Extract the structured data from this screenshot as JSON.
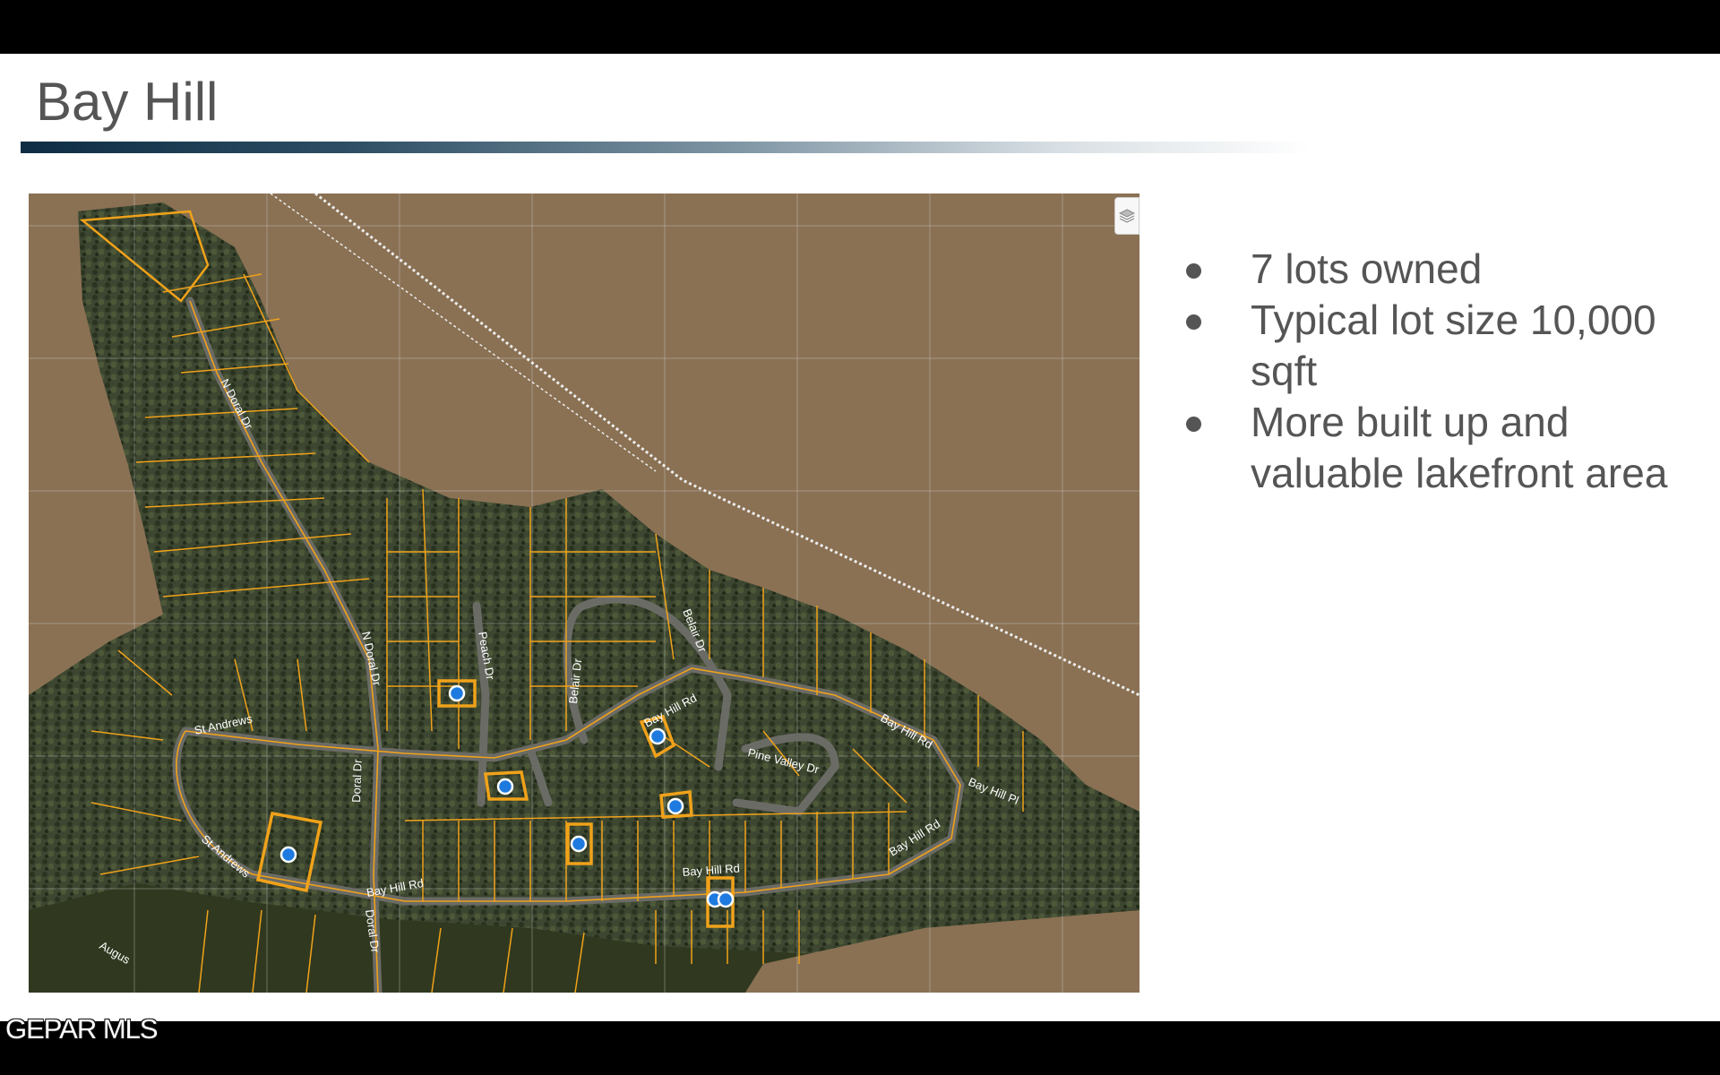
{
  "slide": {
    "title": "Bay Hill",
    "bullets": [
      "7 lots owned",
      "Typical lot size 10,000 sqft",
      "More built up and valuable lakefront area"
    ]
  },
  "map": {
    "road_labels": {
      "n_doral_dr_1": "N Doral Dr",
      "n_doral_dr_2": "N Doral Dr",
      "doral_dr_1": "Doral Dr",
      "doral_dr_2": "Doral Dr",
      "peach_dr": "Peach Dr",
      "belair_dr_1": "Belair Dr",
      "belair_dr_2": "Belair Dr",
      "st_andrews_1": "St Andrews",
      "st_andrews_2": "St Andrews",
      "bay_hill_rd_1": "Bay Hill Rd",
      "bay_hill_rd_2": "Bay Hill Rd",
      "bay_hill_rd_3": "Bay Hill Rd",
      "bay_hill_rd_4": "Bay Hill Rd",
      "bay_hill_rd_5": "Bay Hill Rd",
      "bay_hill_pl": "Bay Hill Pl",
      "pine_valley_dr": "Pine Valley Dr",
      "augusta": "Augus"
    },
    "colors": {
      "water": "#8a7154",
      "land": "#3c4630",
      "parcel_line": "#f0a21a",
      "owned_lot_marker": "#1f7ae0"
    },
    "icons": {
      "layers_button": "layers-icon"
    }
  },
  "footer": {
    "logo_text": "GEPAR MLS"
  }
}
